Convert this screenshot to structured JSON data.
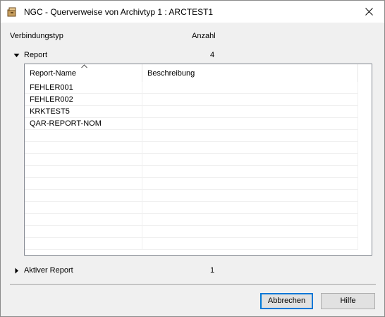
{
  "window": {
    "title": "NGC - Querverweise von Archivtyp 1 : ARCTEST1"
  },
  "columns": {
    "type_label": "Verbindungstyp",
    "count_label": "Anzahl"
  },
  "sections": [
    {
      "label": "Report",
      "count": "4",
      "expanded": true
    },
    {
      "label": "Aktiver Report",
      "count": "1",
      "expanded": false
    }
  ],
  "report_list": {
    "headers": [
      "Report-Name",
      "Beschreibung"
    ],
    "sort_column": "Report-Name",
    "sort_direction": "ascending",
    "rows": [
      [
        "FEHLER001",
        ""
      ],
      [
        "FEHLER002",
        ""
      ],
      [
        "KRKTEST5",
        ""
      ],
      [
        "QAR-REPORT-NOM",
        ""
      ]
    ]
  },
  "buttons": {
    "cancel_label": "Abbrechen",
    "help_label": "Hilfe"
  },
  "colors": {
    "focus_border": "#0078d7",
    "dialog_bg": "#f0f0f0"
  }
}
